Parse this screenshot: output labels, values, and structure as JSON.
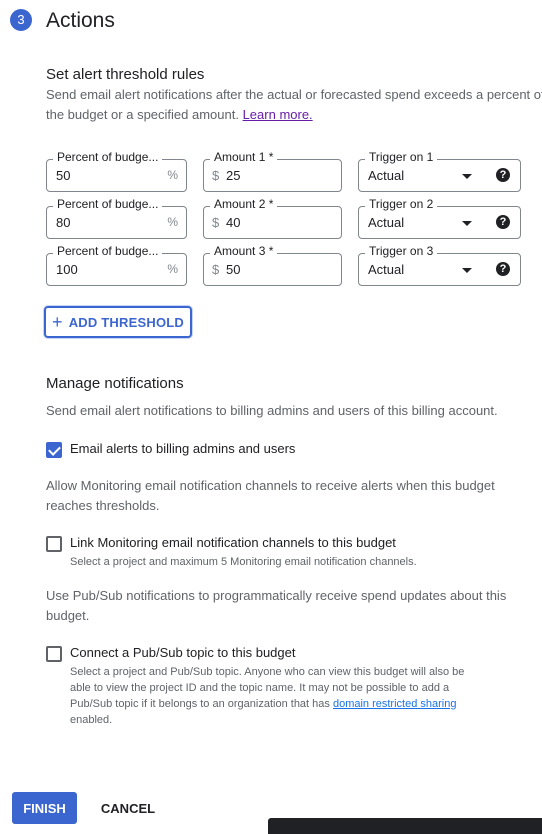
{
  "section": {
    "step_number": "3",
    "title": "Actions"
  },
  "threshold": {
    "heading": "Set alert threshold rules",
    "description_line1": "Send email alert notifications after the actual or forecasted spend exceeds a percent of",
    "description_line2_prefix": "the budget or a specified amount. ",
    "learn_more": "Learn more.",
    "rows": [
      {
        "percent_label": "Percent of budge...",
        "percent_value": "50",
        "percent_suffix": "%",
        "amount_label": "Amount 1 *",
        "amount_prefix": "$",
        "amount_value": "25",
        "trigger_label": "Trigger on 1",
        "trigger_value": "Actual",
        "help_glyph": "?"
      },
      {
        "percent_label": "Percent of budge...",
        "percent_value": "80",
        "percent_suffix": "%",
        "amount_label": "Amount 2 *",
        "amount_prefix": "$",
        "amount_value": "40",
        "trigger_label": "Trigger on 2",
        "trigger_value": "Actual",
        "help_glyph": "?"
      },
      {
        "percent_label": "Percent of budge...",
        "percent_value": "100",
        "percent_suffix": "%",
        "amount_label": "Amount 3 *",
        "amount_prefix": "$",
        "amount_value": "50",
        "trigger_label": "Trigger on 3",
        "trigger_value": "Actual",
        "help_glyph": "?"
      }
    ],
    "add_button_icon": "+",
    "add_button_label": "ADD THRESHOLD"
  },
  "notifications": {
    "heading": "Manage notifications",
    "description": "Send email alert notifications to billing admins and users of this billing account.",
    "email_alerts": {
      "label": "Email alerts to billing admins and users",
      "checked": true
    },
    "monitoring_description_line1": "Allow Monitoring email notification channels to receive alerts when this budget",
    "monitoring_description_line2": "reaches thresholds.",
    "monitoring": {
      "label": "Link Monitoring email notification channels to this budget",
      "sub": "Select a project and maximum 5 Monitoring email notification channels.",
      "checked": false
    },
    "pubsub_description_line1": "Use Pub/Sub notifications to programmatically receive spend updates about this",
    "pubsub_description_line2": "budget.",
    "pubsub": {
      "label": "Connect a Pub/Sub topic to this budget",
      "sub_line1": "Select a project and Pub/Sub topic. Anyone who can view this budget will also be",
      "sub_line2": "able to view the project ID and the topic name. It may not be possible to add a",
      "sub_line3_prefix": "Pub/Sub topic if it belongs to an organization that has ",
      "sub_line3_link": "domain restricted sharing",
      "sub_line4": "enabled.",
      "checked": false
    }
  },
  "footer": {
    "finish_label": "FINISH",
    "cancel_label": "CANCEL"
  },
  "colors": {
    "accent": "#3c66cf",
    "text": "#202124",
    "secondary_text": "#5f6368",
    "visited_link": "#681da8",
    "link": "#1a73e8"
  }
}
